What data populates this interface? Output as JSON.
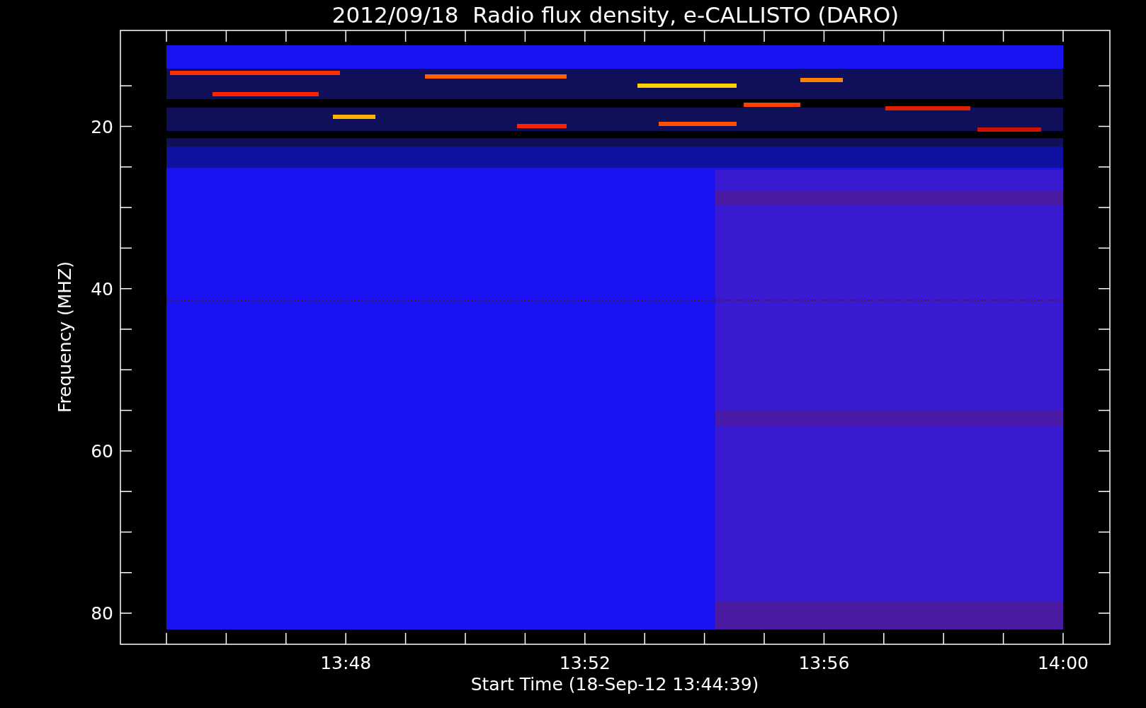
{
  "title": "2012/09/18  Radio flux density, e-CALLISTO (DARO)",
  "y_axis": {
    "label": "Frequency (MHZ)",
    "ticks": [
      "20",
      "40",
      "60",
      "80"
    ]
  },
  "x_axis": {
    "label": "Start Time (18-Sep-12 13:44:39)",
    "ticks": [
      "13:48",
      "13:52",
      "13:56",
      "14:00"
    ]
  }
}
